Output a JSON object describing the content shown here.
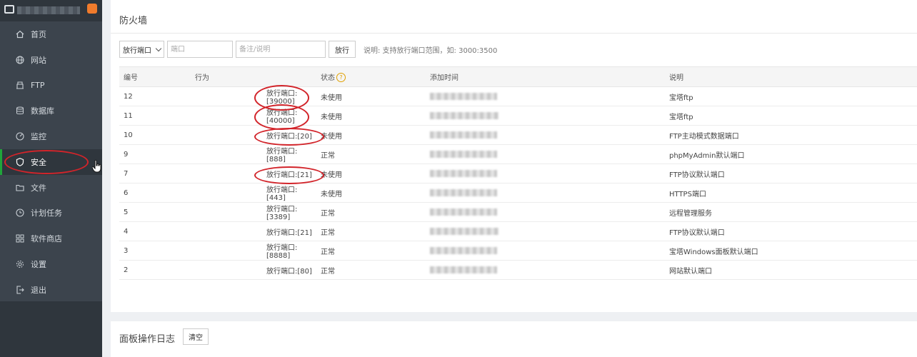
{
  "sidebar": {
    "items": [
      {
        "label": "首页",
        "icon": "home-icon"
      },
      {
        "label": "网站",
        "icon": "globe-icon"
      },
      {
        "label": "FTP",
        "icon": "ftp-icon"
      },
      {
        "label": "数据库",
        "icon": "database-icon"
      },
      {
        "label": "监控",
        "icon": "monitor-icon"
      },
      {
        "label": "安全",
        "icon": "shield-icon",
        "active": true
      },
      {
        "label": "文件",
        "icon": "folder-icon"
      },
      {
        "label": "计划任务",
        "icon": "clock-icon"
      },
      {
        "label": "软件商店",
        "icon": "grid-icon"
      },
      {
        "label": "设置",
        "icon": "gear-icon"
      },
      {
        "label": "退出",
        "icon": "logout-icon"
      }
    ],
    "accent": "#20a53a"
  },
  "firewall": {
    "title": "防火墙",
    "select_value": "放行端口",
    "port_placeholder": "端口",
    "note_placeholder": "备注/说明",
    "submit_label": "放行",
    "hint": "说明: 支持放行端口范围，如: 3000:3500",
    "columns": {
      "id": "编号",
      "action": "行为",
      "status": "状态",
      "time": "添加时间",
      "desc": "说明"
    },
    "rows": [
      {
        "id": "12",
        "action": "放行端口:[39000]",
        "status": "未使用",
        "desc": "宝塔ftp",
        "circled": true
      },
      {
        "id": "11",
        "action": "放行端口:[40000]",
        "status": "未使用",
        "desc": "宝塔ftp",
        "circled": true
      },
      {
        "id": "10",
        "action": "放行端口:[20]",
        "status": "未使用",
        "desc": "FTP主动模式数据端口",
        "circled": true
      },
      {
        "id": "9",
        "action": "放行端口:[888]",
        "status": "正常",
        "desc": "phpMyAdmin默认端口"
      },
      {
        "id": "7",
        "action": "放行端口:[21]",
        "status": "未使用",
        "desc": "FTP协议默认端口",
        "circled": true
      },
      {
        "id": "6",
        "action": "放行端口:[443]",
        "status": "未使用",
        "desc": "HTTPS端口"
      },
      {
        "id": "5",
        "action": "放行端口:[3389]",
        "status": "正常",
        "desc": "远程管理服务"
      },
      {
        "id": "4",
        "action": "放行端口:[21]",
        "status": "正常",
        "desc": "FTP协议默认端口"
      },
      {
        "id": "3",
        "action": "放行端口:[8888]",
        "status": "正常",
        "desc": "宝塔Windows面板默认端口"
      },
      {
        "id": "2",
        "action": "放行端口:[80]",
        "status": "正常",
        "desc": "网站默认端口"
      }
    ]
  },
  "log": {
    "title": "面板操作日志",
    "clear_label": "清空"
  },
  "colors": {
    "annotation": "#d2242a",
    "help": "#e0a000"
  }
}
